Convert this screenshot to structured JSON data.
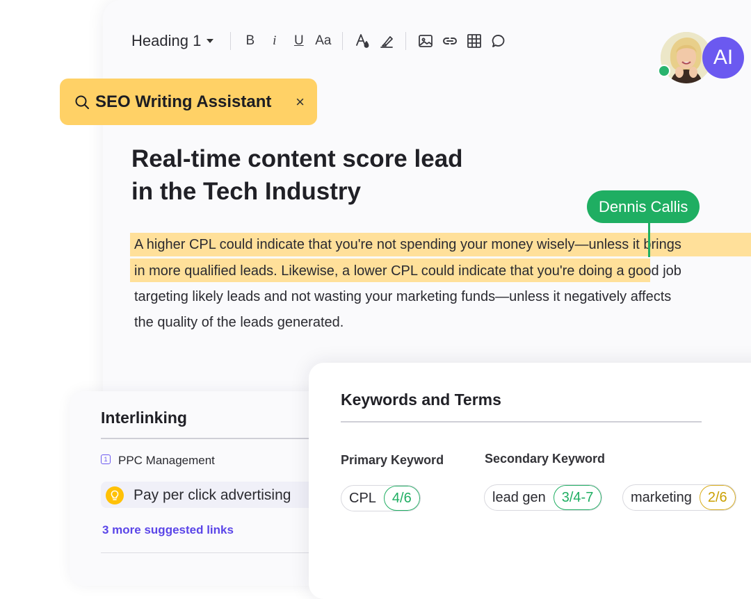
{
  "toolbar": {
    "heading_select": "Heading 1",
    "bold": "B",
    "italic": "i",
    "underline": "U",
    "font_size": "Aa"
  },
  "seo_assistant": {
    "title": "SEO Writing Assistant",
    "close": "×"
  },
  "collaborators": {
    "ai_badge": "AI"
  },
  "article": {
    "title_line1": "Real-time content score lead",
    "title_line2": "in the Tech Industry",
    "paragraph_lines": [
      "A higher CPL could indicate that you're not spending your money wisely—unless it brings",
      "in more qualified leads. Likewise, a lower CPL could indicate that you're doing a good job",
      "targeting likely leads and not wasting your marketing funds—unless it negatively affects",
      "the quality of the leads generated."
    ],
    "collaborator_tag": "Dennis Callis"
  },
  "interlinking": {
    "title": "Interlinking",
    "item_number": "1",
    "item_label": "PPC Management",
    "suggestion": "Pay per click advertising",
    "more_link": "3 more suggested links"
  },
  "keywords": {
    "title": "Keywords and Terms",
    "primary_label": "Primary Keyword",
    "secondary_label": "Secondary Keyword",
    "primary": [
      {
        "name": "CPL",
        "count": "4/6"
      }
    ],
    "secondary": [
      {
        "name": "lead gen",
        "count": "3/4-7"
      },
      {
        "name": "marketing",
        "count": "2/6"
      }
    ]
  },
  "colors": {
    "seo_pill": "#ffd166",
    "highlight": "#ffe09a",
    "collaborator": "#1fae62",
    "ai_badge": "#6b59f0",
    "link": "#5a45e8",
    "count_ok": "#1fae62",
    "count_warn": "#caa000"
  }
}
